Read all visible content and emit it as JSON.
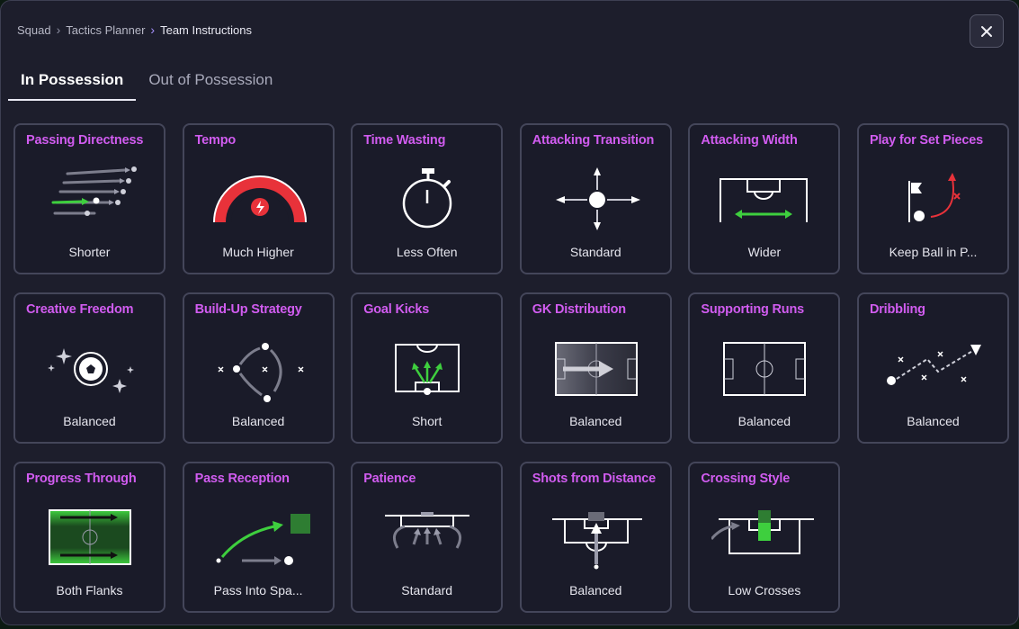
{
  "breadcrumb": {
    "items": [
      "Squad",
      "Tactics Planner",
      "Team Instructions"
    ]
  },
  "tabs": [
    {
      "label": "In Possession",
      "active": true
    },
    {
      "label": "Out of Possession",
      "active": false
    }
  ],
  "accent": {
    "title": "#d15cf0",
    "green": "#3ecf3e",
    "red": "#e8323a"
  },
  "cards": [
    {
      "title": "Passing Directness",
      "value": "Shorter",
      "icon": "arrows-icon"
    },
    {
      "title": "Tempo",
      "value": "Much Higher",
      "icon": "speed-gauge-icon"
    },
    {
      "title": "Time Wasting",
      "value": "Less Often",
      "icon": "stopwatch-icon"
    },
    {
      "title": "Attacking Transition",
      "value": "Standard",
      "icon": "cross-arrows-icon"
    },
    {
      "title": "Attacking Width",
      "value": "Wider",
      "icon": "pitch-width-icon"
    },
    {
      "title": "Play for Set Pieces",
      "value": "Keep Ball in P...",
      "icon": "corner-flag-icon"
    },
    {
      "title": "Creative Freedom",
      "value": "Balanced",
      "icon": "sparkle-ball-icon"
    },
    {
      "title": "Build-Up Strategy",
      "value": "Balanced",
      "icon": "build-up-icon"
    },
    {
      "title": "Goal Kicks",
      "value": "Short",
      "icon": "goal-kick-icon"
    },
    {
      "title": "GK Distribution",
      "value": "Balanced",
      "icon": "gk-distribution-icon"
    },
    {
      "title": "Supporting Runs",
      "value": "Balanced",
      "icon": "supporting-runs-icon"
    },
    {
      "title": "Dribbling",
      "value": "Balanced",
      "icon": "dribbling-icon"
    },
    {
      "title": "Progress Through",
      "value": "Both Flanks",
      "icon": "flanks-icon"
    },
    {
      "title": "Pass Reception",
      "value": "Pass Into Spa...",
      "icon": "pass-reception-icon"
    },
    {
      "title": "Patience",
      "value": "Standard",
      "icon": "patience-icon"
    },
    {
      "title": "Shots from Distance",
      "value": "Balanced",
      "icon": "shots-icon"
    },
    {
      "title": "Crossing Style",
      "value": "Low Crosses",
      "icon": "crossing-icon"
    }
  ]
}
